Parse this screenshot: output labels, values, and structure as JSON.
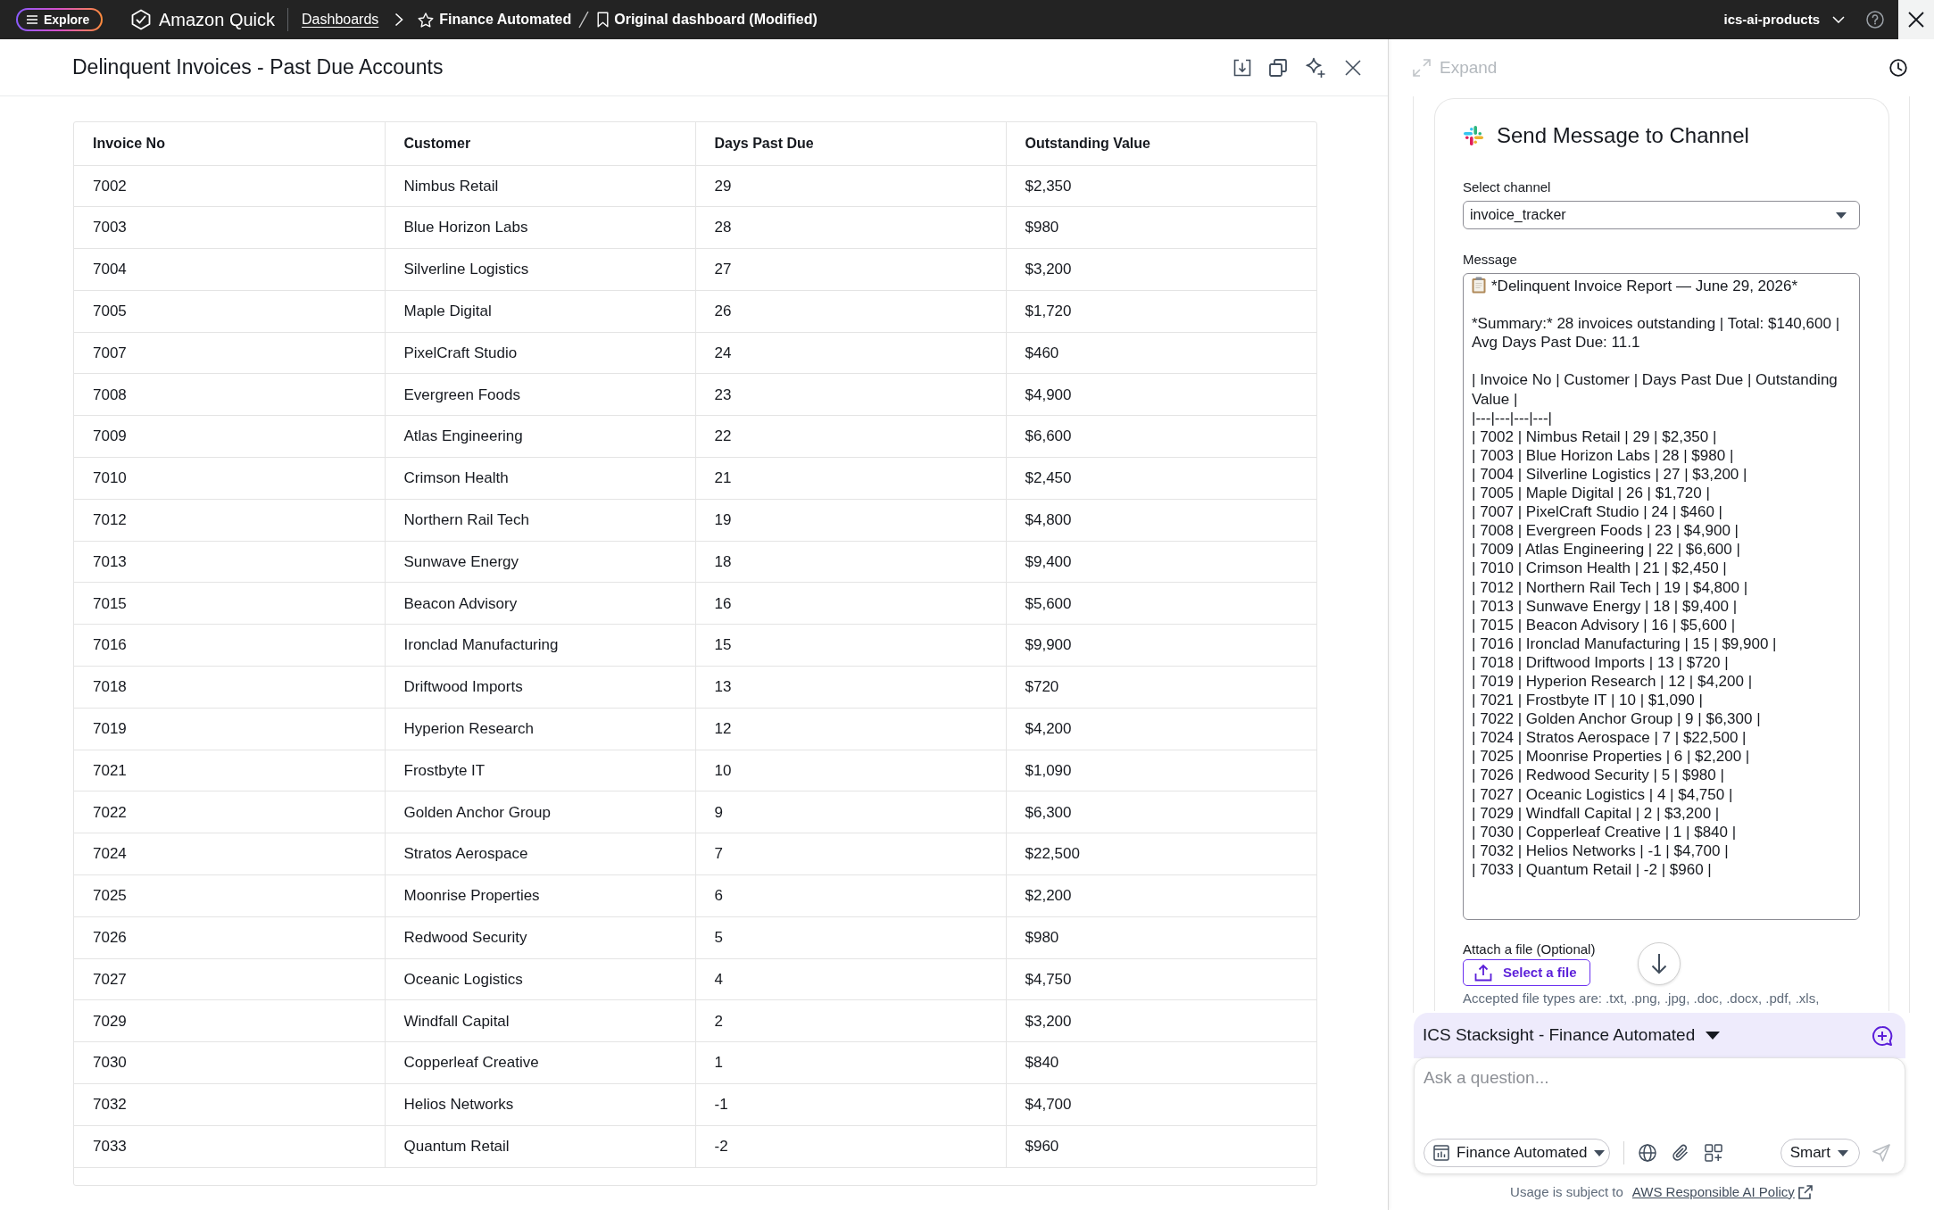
{
  "top_bar": {
    "explore_button": "Explore",
    "app_name": "Amazon Quick",
    "breadcrumbs": [
      {
        "label": "Dashboards",
        "kind": "link"
      },
      {
        "label": "Finance Automated",
        "kind": "starred"
      },
      {
        "label": "Original dashboard (Modified)",
        "kind": "bookmarked"
      }
    ],
    "account": "ics-ai-products"
  },
  "visual": {
    "title": "Delinquent Invoices - Past Due Accounts",
    "table": {
      "columns": [
        "Invoice No",
        "Customer",
        "Days Past Due",
        "Outstanding Value"
      ],
      "rows": [
        [
          "7002",
          "Nimbus Retail",
          "29",
          "$2,350"
        ],
        [
          "7003",
          "Blue Horizon Labs",
          "28",
          "$980"
        ],
        [
          "7004",
          "Silverline Logistics",
          "27",
          "$3,200"
        ],
        [
          "7005",
          "Maple Digital",
          "26",
          "$1,720"
        ],
        [
          "7007",
          "PixelCraft Studio",
          "24",
          "$460"
        ],
        [
          "7008",
          "Evergreen Foods",
          "23",
          "$4,900"
        ],
        [
          "7009",
          "Atlas Engineering",
          "22",
          "$6,600"
        ],
        [
          "7010",
          "Crimson Health",
          "21",
          "$2,450"
        ],
        [
          "7012",
          "Northern Rail Tech",
          "19",
          "$4,800"
        ],
        [
          "7013",
          "Sunwave Energy",
          "18",
          "$9,400"
        ],
        [
          "7015",
          "Beacon Advisory",
          "16",
          "$5,600"
        ],
        [
          "7016",
          "Ironclad Manufacturing",
          "15",
          "$9,900"
        ],
        [
          "7018",
          "Driftwood Imports",
          "13",
          "$720"
        ],
        [
          "7019",
          "Hyperion Research",
          "12",
          "$4,200"
        ],
        [
          "7021",
          "Frostbyte IT",
          "10",
          "$1,090"
        ],
        [
          "7022",
          "Golden Anchor Group",
          "9",
          "$6,300"
        ],
        [
          "7024",
          "Stratos Aerospace",
          "7",
          "$22,500"
        ],
        [
          "7025",
          "Moonrise Properties",
          "6",
          "$2,200"
        ],
        [
          "7026",
          "Redwood Security",
          "5",
          "$980"
        ],
        [
          "7027",
          "Oceanic Logistics",
          "4",
          "$4,750"
        ],
        [
          "7029",
          "Windfall Capital",
          "2",
          "$3,200"
        ],
        [
          "7030",
          "Copperleaf Creative",
          "1",
          "$840"
        ],
        [
          "7032",
          "Helios Networks",
          "-1",
          "$4,700"
        ],
        [
          "7033",
          "Quantum Retail",
          "-2",
          "$960"
        ]
      ]
    }
  },
  "side_panel": {
    "expand": {
      "label": "Expand",
      "disabled": true
    },
    "message_card": {
      "title": "Send Message to Channel",
      "channel_label": "Select channel",
      "channel": "invoice_tracker",
      "message_label": "Message",
      "message": "*Delinquent Invoice Report — June 29, 2026*\n\n*Summary:* 28 invoices outstanding | Total: $140,600 | Avg Days Past Due: 11.1\n\n| Invoice No | Customer | Days Past Due | Outstanding Value |\n|---|---|---|---|\n| 7002 | Nimbus Retail | 29 | $2,350 |\n| 7003 | Blue Horizon Labs | 28 | $980 |\n| 7004 | Silverline Logistics | 27 | $3,200 |\n| 7005 | Maple Digital | 26 | $1,720 |\n| 7007 | PixelCraft Studio | 24 | $460 |\n| 7008 | Evergreen Foods | 23 | $4,900 |\n| 7009 | Atlas Engineering | 22 | $6,600 |\n| 7010 | Crimson Health | 21 | $2,450 |\n| 7012 | Northern Rail Tech | 19 | $4,800 |\n| 7013 | Sunwave Energy | 18 | $9,400 |\n| 7015 | Beacon Advisory | 16 | $5,600 |\n| 7016 | Ironclad Manufacturing | 15 | $9,900 |\n| 7018 | Driftwood Imports | 13 | $720 |\n| 7019 | Hyperion Research | 12 | $4,200 |\n| 7021 | Frostbyte IT | 10 | $1,090 |\n| 7022 | Golden Anchor Group | 9 | $6,300 |\n| 7024 | Stratos Aerospace | 7 | $22,500 |\n| 7025 | Moonrise Properties | 6 | $2,200 |\n| 7026 | Redwood Security | 5 | $980 |\n| 7027 | Oceanic Logistics | 4 | $4,750 |\n| 7029 | Windfall Capital | 2 | $3,200 |\n| 7030 | Copperleaf Creative | 1 | $840 |\n| 7032 | Helios Networks | -1 | $4,700 |\n| 7033 | Quantum Retail | -2 | $960 |",
      "attach_label": "Attach a file (Optional)",
      "attach_button": "Select a file",
      "accepted_types_note": "Accepted file types are: .txt, .png, .jpg, .doc, .docx, .pdf, .xls,"
    }
  },
  "chat": {
    "topic": "ICS Stacksight - Finance Automated",
    "question": {
      "placeholder": "Ask a question..."
    },
    "dataset_button": "Finance Automated",
    "mode_button": "Smart",
    "send_button": {
      "disabled": true
    }
  },
  "footer": {
    "note": "Usage is subject to",
    "link": "AWS Responsible AI Policy"
  }
}
